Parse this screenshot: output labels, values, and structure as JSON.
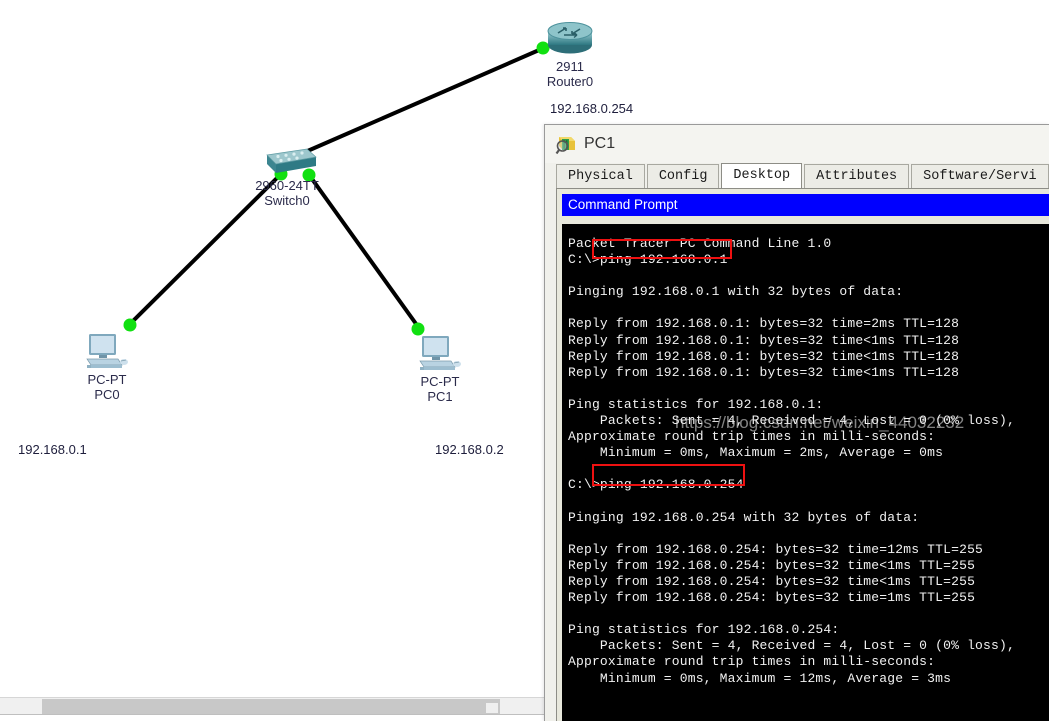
{
  "topology": {
    "devices": [
      {
        "id": "router0",
        "icon": "router-icon",
        "model": "2911",
        "name": "Router0",
        "ip_label": "192.168.0.254"
      },
      {
        "id": "switch0",
        "icon": "switch-icon",
        "model": "2960-24TT",
        "name": "Switch0",
        "ip_label": ""
      },
      {
        "id": "pc0",
        "icon": "pc-icon",
        "model": "PC-PT",
        "name": "PC0",
        "ip_label": "192.168.0.1"
      },
      {
        "id": "pc1",
        "icon": "pc-icon",
        "model": "PC-PT",
        "name": "PC1",
        "ip_label": "192.168.0.2"
      }
    ],
    "links": [
      {
        "from": "switch0",
        "to": "router0"
      },
      {
        "from": "switch0",
        "to": "pc0"
      },
      {
        "from": "switch0",
        "to": "pc1"
      }
    ],
    "link_status_color": "#11e011",
    "link_line_color": "#000000"
  },
  "pc_window": {
    "icon": "inspect-device-icon",
    "title": "PC1",
    "tabs": [
      {
        "label": "Physical",
        "active": false
      },
      {
        "label": "Config",
        "active": false
      },
      {
        "label": "Desktop",
        "active": true
      },
      {
        "label": "Attributes",
        "active": false
      },
      {
        "label": "Software/Servi",
        "active": false
      }
    ],
    "command_prompt": {
      "title": "Command Prompt",
      "title_bg": "#0000FF",
      "terminal_bg": "#000000",
      "terminal_fg": "#F2F2F2",
      "output": "Packet Tracer PC Command Line 1.0\nC:\\>ping 192.168.0.1\n\nPinging 192.168.0.1 with 32 bytes of data:\n\nReply from 192.168.0.1: bytes=32 time=2ms TTL=128\nReply from 192.168.0.1: bytes=32 time<1ms TTL=128\nReply from 192.168.0.1: bytes=32 time<1ms TTL=128\nReply from 192.168.0.1: bytes=32 time<1ms TTL=128\n\nPing statistics for 192.168.0.1:\n    Packets: Sent = 4, Received = 4, Lost = 0 (0% loss),\nApproximate round trip times in milli-seconds:\n    Minimum = 0ms, Maximum = 2ms, Average = 0ms\n\nC:\\>ping 192.168.0.254\n\nPinging 192.168.0.254 with 32 bytes of data:\n\nReply from 192.168.0.254: bytes=32 time=12ms TTL=255\nReply from 192.168.0.254: bytes=32 time<1ms TTL=255\nReply from 192.168.0.254: bytes=32 time<1ms TTL=255\nReply from 192.168.0.254: bytes=32 time=1ms TTL=255\n\nPing statistics for 192.168.0.254:\n    Packets: Sent = 4, Received = 4, Lost = 0 (0% loss),\nApproximate round trip times in milli-seconds:\n    Minimum = 0ms, Maximum = 12ms, Average = 3ms",
      "annotations": [
        {
          "label": "ping 192.168.0.1",
          "color": "#EE1111"
        },
        {
          "label": "ping 192.168.0.254",
          "color": "#EE1111"
        }
      ]
    }
  },
  "watermark": {
    "text": "https://blog.csdn.net/weixin_44032232"
  }
}
